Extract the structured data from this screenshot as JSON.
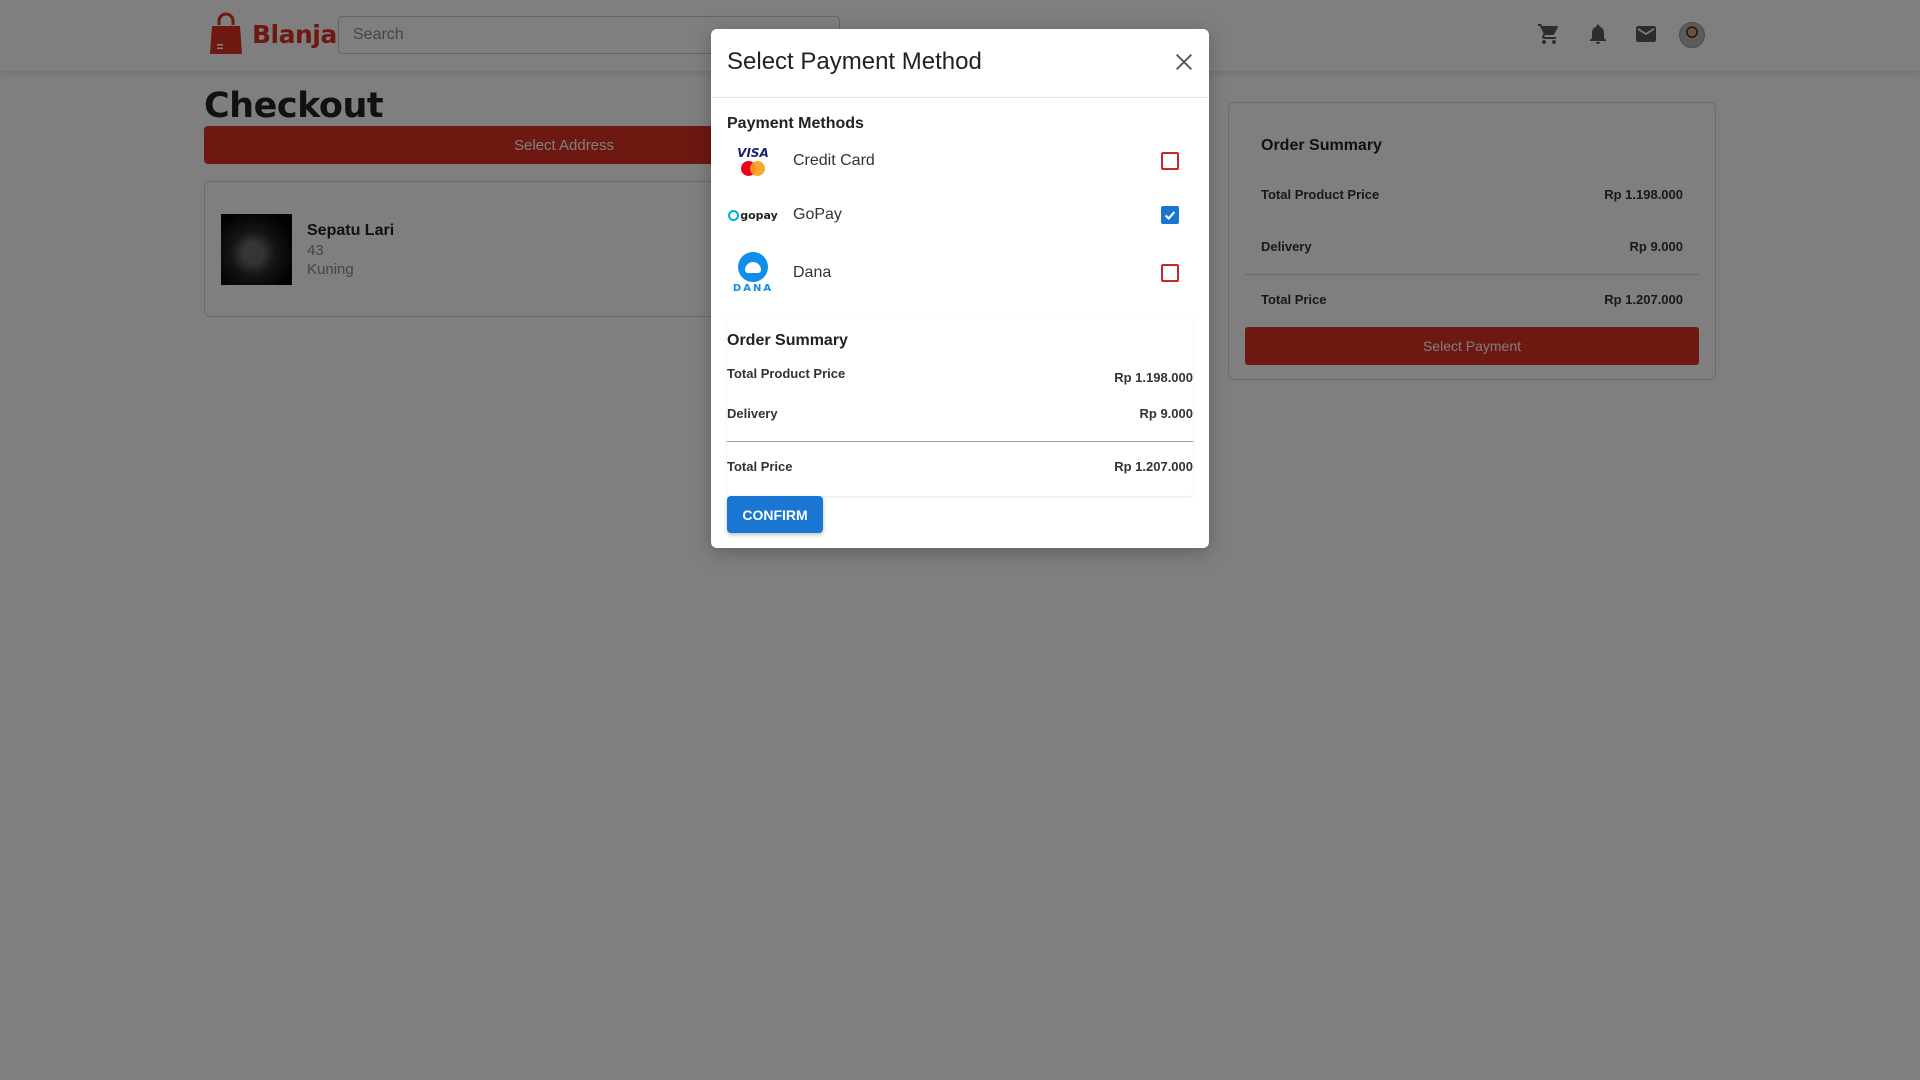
{
  "header": {
    "brand": "Blanja",
    "search_placeholder": "Search",
    "icons": [
      "cart-icon",
      "bell-icon",
      "mail-icon",
      "avatar"
    ]
  },
  "page": {
    "title": "Checkout",
    "address_button": "Select Address"
  },
  "product": {
    "name": "Sepatu Lari",
    "size": "43",
    "color": "Kuning"
  },
  "summary": {
    "title": "Order Summary",
    "product_price_label": "Total Product Price",
    "product_price": "Rp 1.198.000",
    "delivery_label": "Delivery",
    "delivery": "Rp 9.000",
    "total_label": "Total Price",
    "total": "Rp 1.207.000",
    "button": "Select Payment"
  },
  "modal": {
    "title": "Select Payment Method",
    "methods_heading": "Payment Methods",
    "methods": [
      {
        "label": "Credit Card",
        "logo": "visa-mastercard-logo",
        "checked": false
      },
      {
        "label": "GoPay",
        "logo": "gopay-logo",
        "checked": true
      },
      {
        "label": "Dana",
        "logo": "dana-logo",
        "checked": false
      }
    ],
    "summary_title": "Order Summary",
    "product_price_label": "Total Product Price",
    "product_price": "Rp 1.198.000",
    "delivery_label": "Delivery",
    "delivery": "Rp 9.000",
    "total_label": "Total Price",
    "total": "Rp 1.207.000",
    "confirm": "CONFIRM"
  },
  "colors": {
    "brand": "#db3022",
    "primary": "#1976d2",
    "overlay": "rgba(0,0,0,0.5)"
  }
}
